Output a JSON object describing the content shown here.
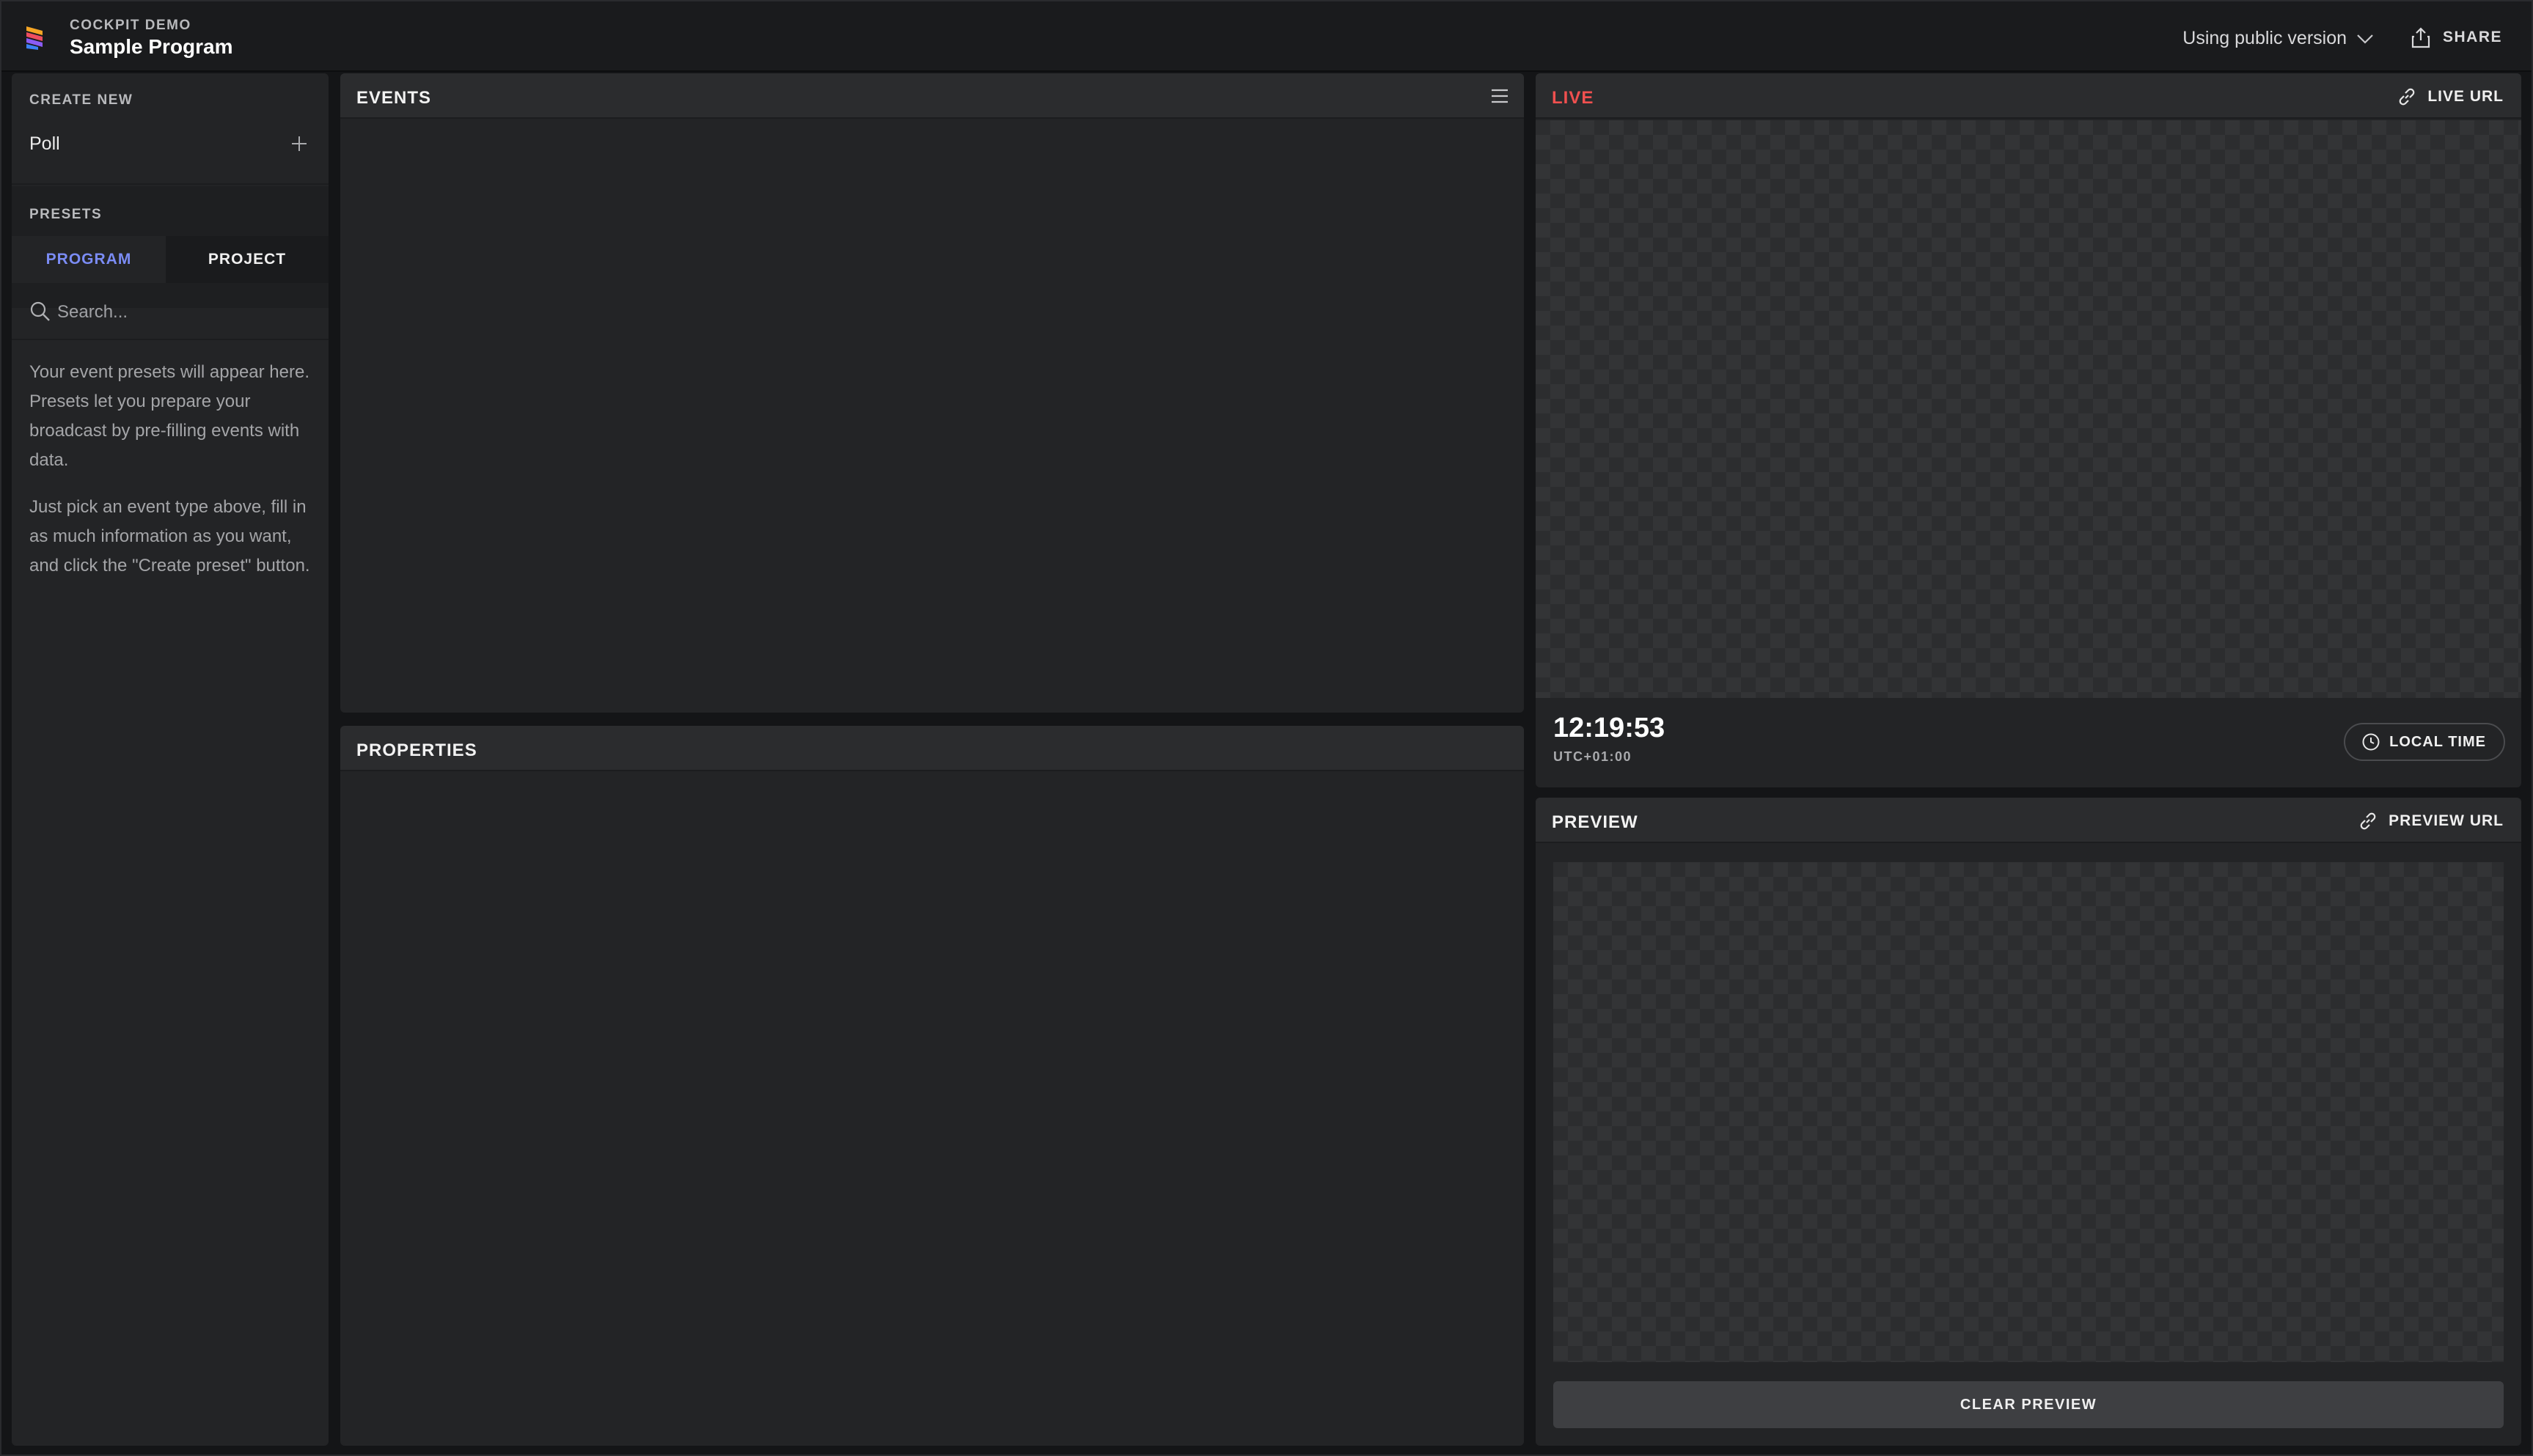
{
  "header": {
    "brand_sub": "COCKPIT DEMO",
    "title": "Sample Program",
    "version_label": "Using public version",
    "share_label": "SHARE"
  },
  "sidebar": {
    "create_new_label": "CREATE NEW",
    "create_items": [
      {
        "label": "Poll",
        "icon": "plus-icon"
      }
    ],
    "presets_label": "PRESETS",
    "tabs": [
      {
        "label": "PROGRAM",
        "active": true
      },
      {
        "label": "PROJECT",
        "active": false
      }
    ],
    "search": {
      "placeholder": "Search...",
      "value": ""
    },
    "help_paragraphs": [
      "Your event presets will appear here. Presets let you prepare your broadcast by pre-filling events with data.",
      "Just pick an event type above, fill in as much information as you want, and click the \"Create preset\" button."
    ]
  },
  "events": {
    "title": "EVENTS",
    "menu_icon": "hamburger-menu-icon"
  },
  "properties": {
    "title": "PROPERTIES"
  },
  "live": {
    "title": "LIVE",
    "url_label": "LIVE URL",
    "time": "12:19:53",
    "timezone": "UTC+01:00",
    "local_time_label": "LOCAL TIME"
  },
  "preview": {
    "title": "PREVIEW",
    "url_label": "PREVIEW URL",
    "clear_label": "CLEAR PREVIEW"
  },
  "colors": {
    "accent": "#7b8cf5",
    "live_red": "#f0504f",
    "panel_bg": "#232426",
    "app_bg": "#141517"
  }
}
